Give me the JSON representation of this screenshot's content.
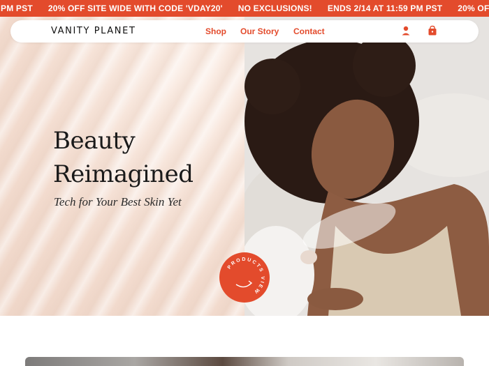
{
  "ticker": {
    "items": [
      "PM PST",
      "20% OFF SITE WIDE WITH CODE 'VDAY20'",
      "NO EXCLUSIONS!",
      "ENDS 2/14 AT 11:59 PM PST",
      "20% OFF SITE WI"
    ]
  },
  "nav": {
    "logo": "VANITY PLANET",
    "links": [
      "Shop",
      "Our Story",
      "Contact"
    ],
    "icons": [
      "account-icon",
      "cart-icon"
    ]
  },
  "hero": {
    "title_line1": "Beauty",
    "title_line2": "Reimagined",
    "subtitle": "Tech for Your Best Skin Yet",
    "badge_text": "PRODUCTS VIEW"
  },
  "colors": {
    "accent": "#e34b2c",
    "hero_left_bg": "#f3dccf",
    "text_dark": "#1a1a1a"
  }
}
